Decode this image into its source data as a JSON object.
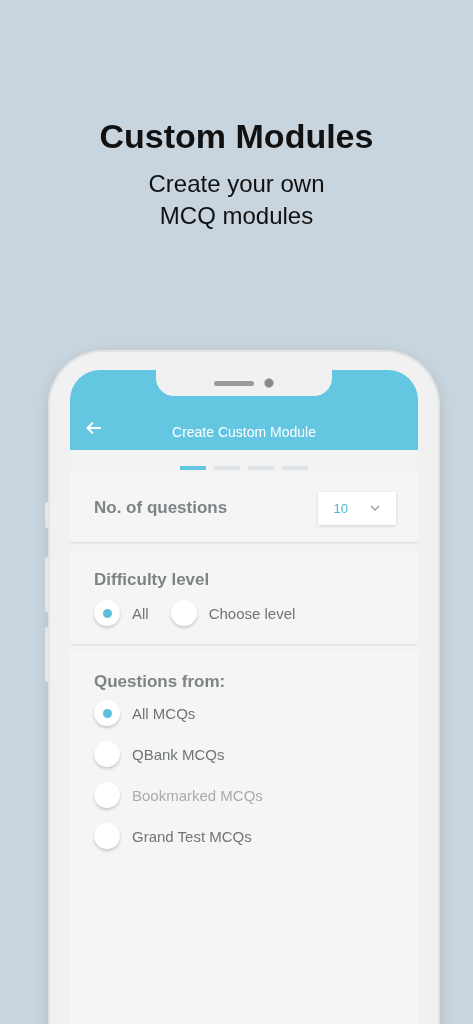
{
  "promo": {
    "title": "Custom Modules",
    "subtitle_lines": [
      "Create your own",
      "MCQ modules"
    ]
  },
  "app_bar": {
    "title": "Create Custom Module"
  },
  "steps": [
    {
      "selected": true
    },
    {
      "selected": false
    },
    {
      "selected": false
    },
    {
      "selected": false
    }
  ],
  "question_count": {
    "label": "No. of questions",
    "value": "10"
  },
  "difficulty": {
    "label": "Difficulty level",
    "options": [
      {
        "label": "All",
        "selected": true
      },
      {
        "label": "Choose level",
        "selected": false
      }
    ]
  },
  "source": {
    "label": "Questions from:",
    "options": [
      {
        "label": "All MCQs",
        "selected": true,
        "disabled": false
      },
      {
        "label": "QBank MCQs",
        "selected": false,
        "disabled": false
      },
      {
        "label": "Bookmarked MCQs",
        "selected": false,
        "disabled": true
      },
      {
        "label": "Grand Test MCQs",
        "selected": false,
        "disabled": false
      }
    ]
  }
}
